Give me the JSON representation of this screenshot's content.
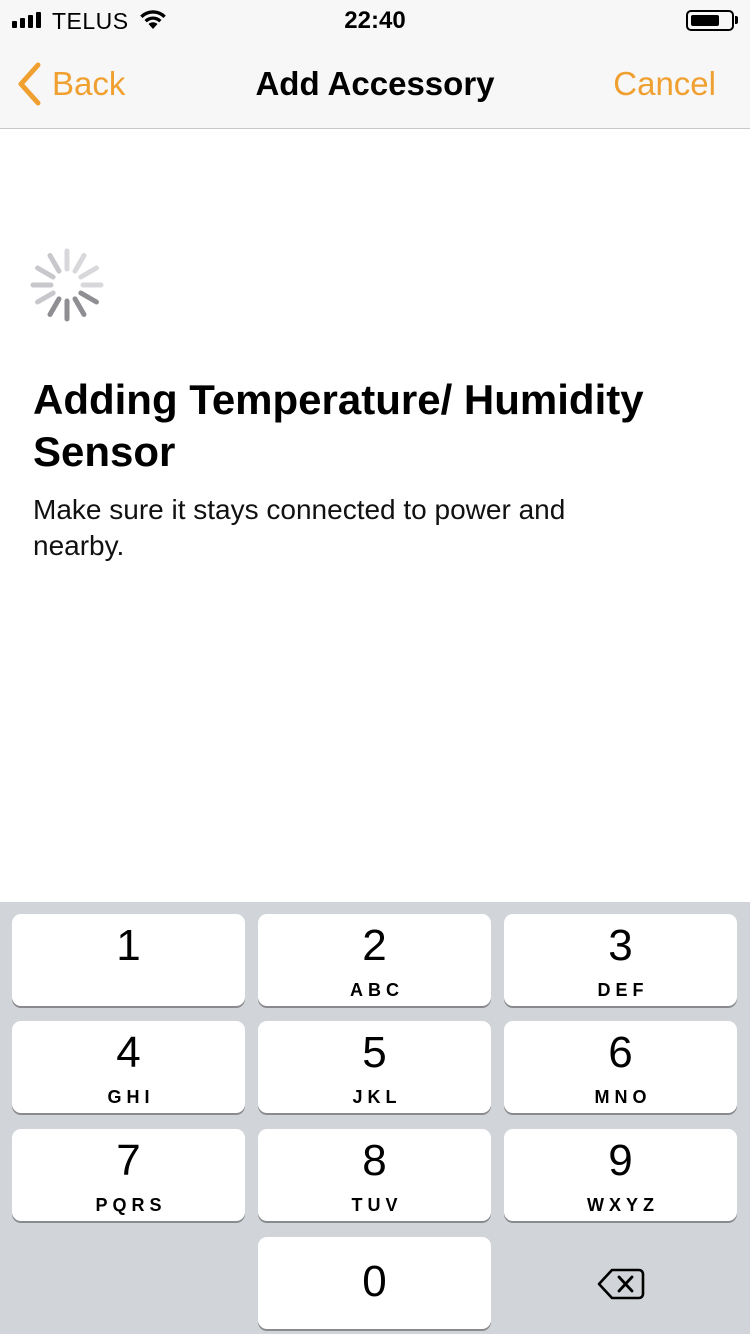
{
  "status_bar": {
    "carrier": "TELUS",
    "time": "22:40",
    "icons": [
      "signal-icon",
      "wifi-icon",
      "battery-icon"
    ]
  },
  "nav": {
    "back_label": "Back",
    "title": "Add Accessory",
    "cancel_label": "Cancel",
    "accent_color": "#f0a030"
  },
  "content": {
    "heading": "Adding Temperature/ Humidity Sensor",
    "subtext": "Make sure it stays connected to power and nearby."
  },
  "keypad": {
    "keys": [
      {
        "digit": "1",
        "letters": ""
      },
      {
        "digit": "2",
        "letters": "ABC"
      },
      {
        "digit": "3",
        "letters": "DEF"
      },
      {
        "digit": "4",
        "letters": "GHI"
      },
      {
        "digit": "5",
        "letters": "JKL"
      },
      {
        "digit": "6",
        "letters": "MNO"
      },
      {
        "digit": "7",
        "letters": "PQRS"
      },
      {
        "digit": "8",
        "letters": "TUV"
      },
      {
        "digit": "9",
        "letters": "WXYZ"
      },
      {
        "digit": "0",
        "letters": ""
      }
    ],
    "delete_icon": "delete-backspace-icon"
  }
}
